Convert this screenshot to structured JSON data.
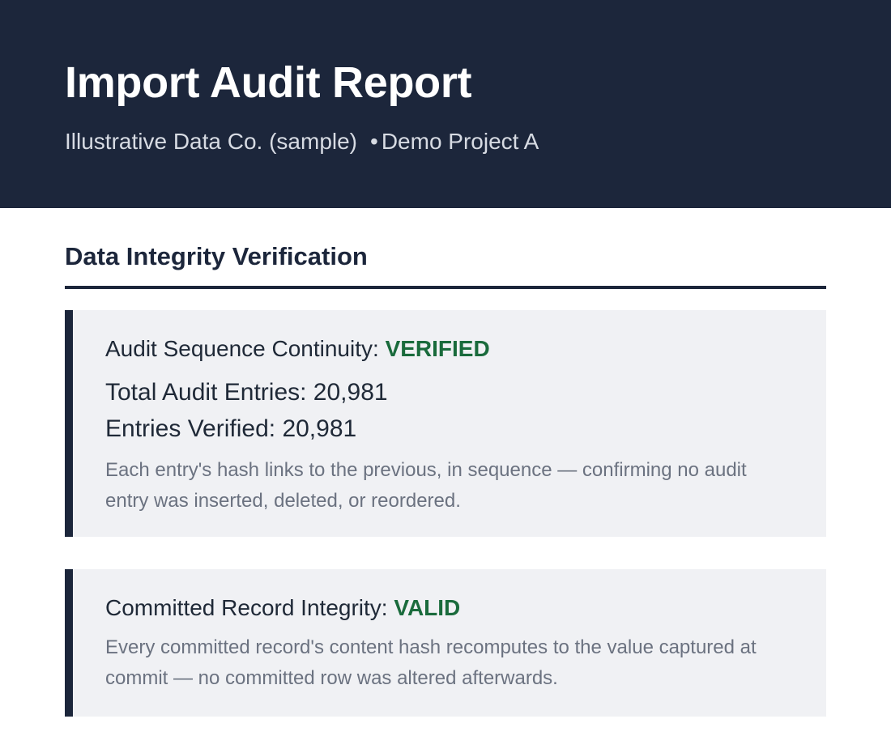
{
  "header": {
    "title": "Import Audit Report",
    "organization": "Illustrative Data Co. (sample)",
    "separator": "•",
    "project": "Demo Project A"
  },
  "section": {
    "title": "Data Integrity Verification"
  },
  "cards": [
    {
      "label": "Audit Sequence Continuity:",
      "status": "VERIFIED",
      "stats": [
        "Total Audit Entries: 20,981",
        "Entries Verified: 20,981"
      ],
      "note": "Each entry's hash links to the previous, in sequence — confirming no audit entry was inserted, deleted, or reordered."
    },
    {
      "label": "Committed Record Integrity:",
      "status": "VALID",
      "note": "Every committed record's content hash recomputes to the value captured at commit — no committed row was altered afterwards."
    }
  ],
  "colors": {
    "header_bg": "#1c263b",
    "status_ok": "#1a6b3c",
    "card_bg": "#f0f1f4",
    "note_text": "#6b7280"
  }
}
